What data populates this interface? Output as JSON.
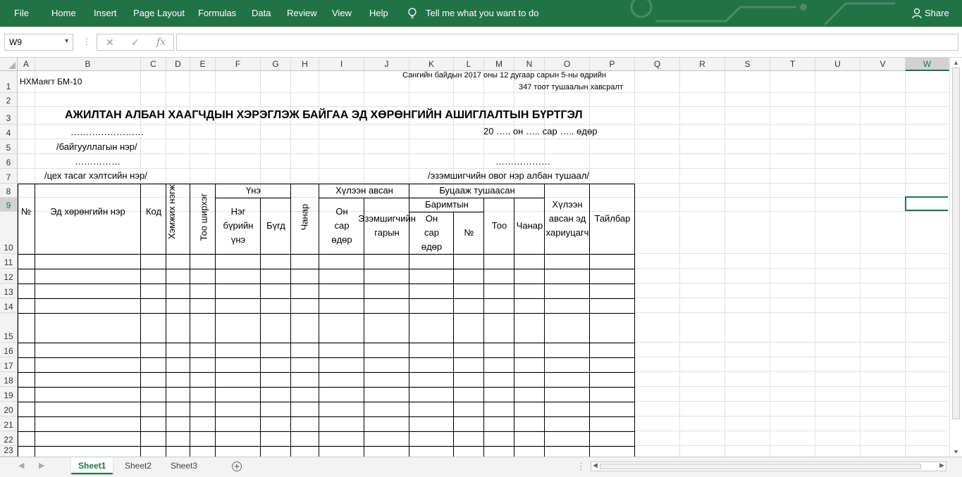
{
  "ribbon": {
    "tabs": [
      "File",
      "Home",
      "Insert",
      "Page Layout",
      "Formulas",
      "Data",
      "Review",
      "View",
      "Help"
    ],
    "tell_me": "Tell me what you want to do",
    "share": "Share",
    "accent": "#217346"
  },
  "formula_bar": {
    "name_box": "W9",
    "fx": "fx",
    "cancel": "✕",
    "confirm": "✓",
    "value": ""
  },
  "columns": [
    "A",
    "B",
    "C",
    "D",
    "E",
    "F",
    "G",
    "H",
    "I",
    "J",
    "K",
    "L",
    "M",
    "N",
    "O",
    "P",
    "Q",
    "R",
    "S",
    "T",
    "U",
    "V",
    "W"
  ],
  "selected_column": "W",
  "rows": [
    "1",
    "2",
    "3",
    "4",
    "5",
    "6",
    "7",
    "8",
    "9",
    "10",
    "11",
    "12",
    "13",
    "14",
    "15",
    "16",
    "17",
    "18",
    "19",
    "20",
    "21",
    "22",
    "23"
  ],
  "selected_row": "9",
  "sheet": {
    "a1": "НХМаягт БМ-10",
    "k1_line1": "Сангийн байдын  2017 оны 12 дугаар сарын 5-ны өдрийн",
    "k1_line2": "347 тоот тушаалын хавсралт",
    "title": "АЖИЛТАН АЛБАН ХААГЧДЫН ХЭРЭГЛЭЖ БАЙГАА ЭД ХӨРӨНГИЙН АШИГЛАЛТЫН БҮРТГЭЛ",
    "b4": "……………………",
    "date_line": "20 ….. он ….. сар ….. өдөр",
    "b5": "/байгууллагын нэр/",
    "b6": "……………",
    "n6": "………………",
    "b7": "/цех тасаг хэлтсийн нэр/",
    "n7": "/эзэмшигчийн овог нэр албан тушаал/",
    "headers": {
      "no": "№",
      "name": "Эд хөрөнгийн нэр",
      "code": "Код",
      "unit": "Хэмжих нэгж",
      "qty": "Тоо ширхэг",
      "price": "Үнэ",
      "unit_price": "Нэг бүрийн үнэ",
      "total": "Бүгд",
      "quality": "Чанар",
      "received": "Хүлээн авсан",
      "date": "Он сар өдөр",
      "owner_sig": "Эзэмшигчийн гарын",
      "returned": "Буцааж тушаасан",
      "document": "Баримтын",
      "doc_date": "Он сар өдөр",
      "doc_no": "№",
      "ret_qty": "Тоо",
      "ret_quality": "Чанар",
      "responsible": "Хүлээн авсан эд хариуцагч",
      "note": "Тайлбар"
    }
  },
  "sheet_tabs": [
    "Sheet1",
    "Sheet2",
    "Sheet3"
  ],
  "active_sheet": "Sheet1"
}
